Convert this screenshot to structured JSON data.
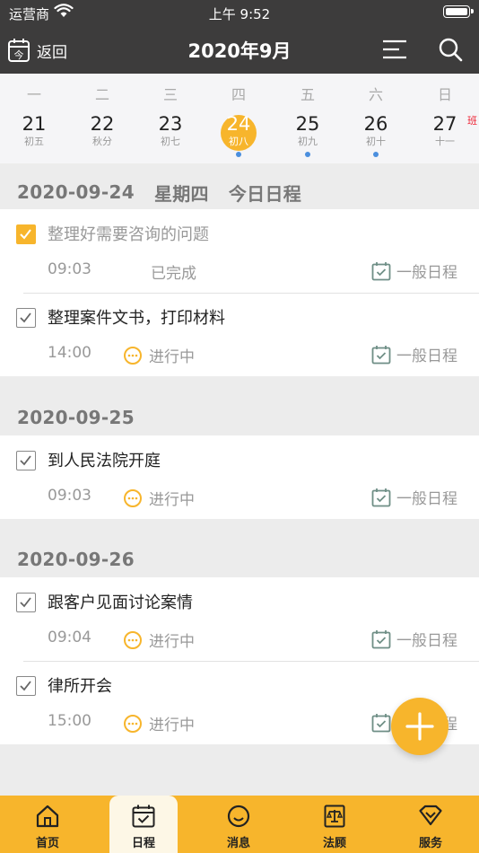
{
  "status_bar": {
    "carrier": "运营商",
    "time": "上午 9:52"
  },
  "nav": {
    "back_label": "返回",
    "title": "2020年9月",
    "back_icon_char": "今"
  },
  "week": {
    "weekdays": [
      "一",
      "二",
      "三",
      "四",
      "五",
      "六",
      "日"
    ],
    "days": [
      {
        "num": "21",
        "lunar": "初五",
        "dot": false,
        "today": false,
        "badge": ""
      },
      {
        "num": "22",
        "lunar": "秋分",
        "dot": false,
        "today": false,
        "badge": ""
      },
      {
        "num": "23",
        "lunar": "初七",
        "dot": false,
        "today": false,
        "badge": ""
      },
      {
        "num": "24",
        "lunar": "初八",
        "dot": true,
        "today": true,
        "badge": ""
      },
      {
        "num": "25",
        "lunar": "初九",
        "dot": true,
        "today": false,
        "badge": ""
      },
      {
        "num": "26",
        "lunar": "初十",
        "dot": true,
        "today": false,
        "badge": ""
      },
      {
        "num": "27",
        "lunar": "十一",
        "dot": false,
        "today": false,
        "badge": "班"
      }
    ]
  },
  "sections": [
    {
      "date": "2020-09-24",
      "weekday": "星期四",
      "tag": "今日日程",
      "items": [
        {
          "title": "整理好需要咨询的问题",
          "time": "09:03",
          "status": "已完成",
          "done": true,
          "type": "一般日程"
        },
        {
          "title": "整理案件文书，打印材料",
          "time": "14:00",
          "status": "进行中",
          "done": false,
          "type": "一般日程"
        }
      ]
    },
    {
      "date": "2020-09-25",
      "weekday": "",
      "tag": "",
      "items": [
        {
          "title": "到人民法院开庭",
          "time": "09:03",
          "status": "进行中",
          "done": false,
          "type": "一般日程"
        }
      ]
    },
    {
      "date": "2020-09-26",
      "weekday": "",
      "tag": "",
      "items": [
        {
          "title": "跟客户见面讨论案情",
          "time": "09:04",
          "status": "进行中",
          "done": false,
          "type": "一般日程"
        },
        {
          "title": "律所开会",
          "time": "15:00",
          "status": "进行中",
          "done": false,
          "type": "一般日程"
        }
      ]
    }
  ],
  "tabs": [
    {
      "label": "首页",
      "icon": "home-icon",
      "active": false
    },
    {
      "label": "日程",
      "icon": "calendar-icon",
      "active": true
    },
    {
      "label": "消息",
      "icon": "message-icon",
      "active": false
    },
    {
      "label": "法顾",
      "icon": "law-book-icon",
      "active": false
    },
    {
      "label": "服务",
      "icon": "service-heart-icon",
      "active": false
    }
  ],
  "colors": {
    "accent": "#f7b52c",
    "header": "#3d3c3c",
    "dot": "#4b8fde",
    "calendar_icon": "#6f8f86"
  }
}
